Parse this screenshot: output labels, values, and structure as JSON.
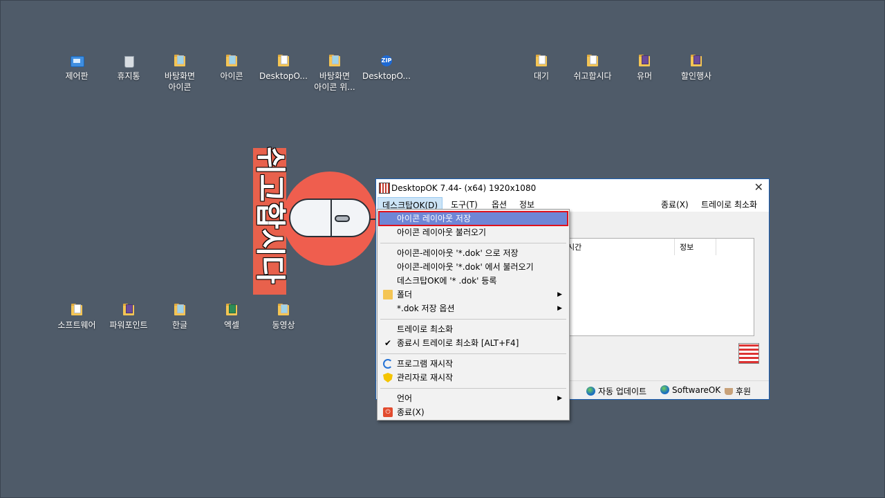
{
  "desktop": {
    "icons_top": [
      {
        "label": "제어판",
        "icon": "control-panel-icon"
      },
      {
        "label": "휴지통",
        "icon": "recycle-bin-icon"
      },
      {
        "label": "바탕화면\n아이콘",
        "icon": "folder-icon"
      },
      {
        "label": "아이콘",
        "icon": "folder-icon"
      },
      {
        "label": "DesktopO...",
        "icon": "folder-icon"
      },
      {
        "label": "바탕화면\n아이콘 위...",
        "icon": "folder-icon"
      },
      {
        "label": "DesktopO...",
        "icon": "zip-icon"
      }
    ],
    "icons_top_right": [
      {
        "label": "대기",
        "icon": "folder-icon"
      },
      {
        "label": "쉬고합시다",
        "icon": "folder-icon"
      },
      {
        "label": "유머",
        "icon": "folder-icon"
      },
      {
        "label": "할인행사",
        "icon": "folder-icon"
      }
    ],
    "icons_bottom": [
      {
        "label": "소프트웨어",
        "icon": "folder-icon"
      },
      {
        "label": "파워포인트",
        "icon": "folder-icon"
      },
      {
        "label": "한글",
        "icon": "folder-icon"
      },
      {
        "label": "엑셀",
        "icon": "folder-icon"
      },
      {
        "label": "동영상",
        "icon": "folder-icon"
      }
    ]
  },
  "overlay": {
    "vertical_text": "쉬고합시다",
    "accent": "#ef5e4e"
  },
  "window": {
    "title": "DesktopOK 7.44- (x64) 1920x1080",
    "close": "✕",
    "menu": {
      "desktop": "데스크탑OK(D)",
      "tools": "도구(T)",
      "options": "옵션",
      "info": "정보",
      "exit": "종료(X)",
      "tray": "트레이로 최소화"
    },
    "table_headers": {
      "time": "시간",
      "info": "정보"
    },
    "status": {
      "update": "자동 업데이트",
      "softwareok": "SoftwareOK",
      "donate": "후원"
    }
  },
  "dropdown": {
    "items": [
      {
        "label": "아이콘 레이아웃 저장",
        "icon": "",
        "arrow": "",
        "highlight": true
      },
      {
        "label": "아이콘 레이아웃 불러오기",
        "icon": "",
        "arrow": ""
      },
      {
        "label": "아이콘-레이아웃 '*.dok' 으로 저장",
        "icon": "",
        "arrow": ""
      },
      {
        "label": "아이콘-레이아웃 '*.dok' 에서 불러오기",
        "icon": "",
        "arrow": ""
      },
      {
        "label": "데스크탑OK에 '* .dok' 등록",
        "icon": "",
        "arrow": ""
      },
      {
        "label": "폴더",
        "icon": "folder-icon",
        "arrow": "▶"
      },
      {
        "label": "*.dok 저장 옵션",
        "icon": "",
        "arrow": "▶"
      },
      {
        "label": "트레이로 최소화",
        "icon": "",
        "arrow": ""
      },
      {
        "label": "종료시 트레이로 최소화 [ALT+F4]",
        "icon": "check-icon",
        "arrow": ""
      },
      {
        "label": "프로그램 재시작",
        "icon": "refresh-icon",
        "arrow": ""
      },
      {
        "label": "관리자로 재시작",
        "icon": "shield-icon",
        "arrow": ""
      },
      {
        "label": "언어",
        "icon": "",
        "arrow": "▶"
      },
      {
        "label": "종료(X)",
        "icon": "power-icon",
        "arrow": ""
      }
    ]
  }
}
